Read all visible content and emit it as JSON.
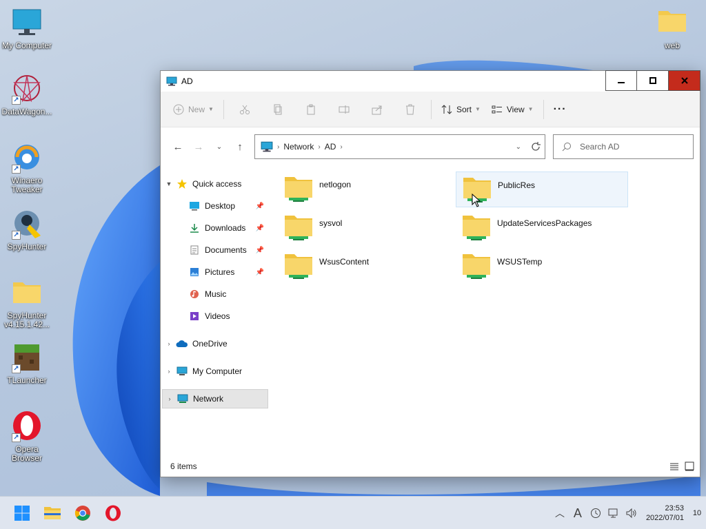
{
  "desktop": {
    "icons": [
      {
        "label": "My Computer",
        "icon": "monitor-icon"
      },
      {
        "label": "DataWagon...",
        "icon": "datawagon-icon"
      },
      {
        "label": "Winaero Tweaker",
        "icon": "winaero-icon"
      },
      {
        "label": "SpyHunter",
        "icon": "spyhunter-icon"
      },
      {
        "label": "SpyHunter v4.15.1.42...",
        "icon": "folder-icon"
      },
      {
        "label": "TLauncher",
        "icon": "tlauncher-icon"
      },
      {
        "label": "Opera Browser",
        "icon": "opera-icon"
      },
      {
        "label": "web",
        "icon": "folder-icon"
      }
    ]
  },
  "window": {
    "title": "AD",
    "toolbar": {
      "new_label": "New",
      "sort_label": "Sort",
      "view_label": "View",
      "more_label": "···"
    },
    "address": {
      "crumbs": [
        "Network",
        "AD"
      ]
    },
    "search": {
      "placeholder": "Search AD"
    },
    "sidebar": {
      "quick_access": "Quick access",
      "items": [
        {
          "label": "Desktop",
          "icon": "desktop-icon",
          "pinned": true
        },
        {
          "label": "Downloads",
          "icon": "download-icon",
          "pinned": true
        },
        {
          "label": "Documents",
          "icon": "document-icon",
          "pinned": true
        },
        {
          "label": "Pictures",
          "icon": "pictures-icon",
          "pinned": true
        },
        {
          "label": "Music",
          "icon": "music-icon",
          "pinned": false
        },
        {
          "label": "Videos",
          "icon": "videos-icon",
          "pinned": false
        }
      ],
      "onedrive": "OneDrive",
      "my_computer": "My Computer",
      "network": "Network"
    },
    "folders": [
      "netlogon",
      "PublicRes",
      "sysvol",
      "UpdateServicesPackages",
      "WsusContent",
      "WSUSTemp"
    ],
    "status": {
      "item_count": "6 items"
    }
  },
  "taskbar": {
    "time": "23:53",
    "date": "2022/07/01",
    "notifications": "10"
  },
  "colors": {
    "accent": "#0078d4",
    "close": "#c42b1c",
    "folder": "#f8d66a"
  }
}
